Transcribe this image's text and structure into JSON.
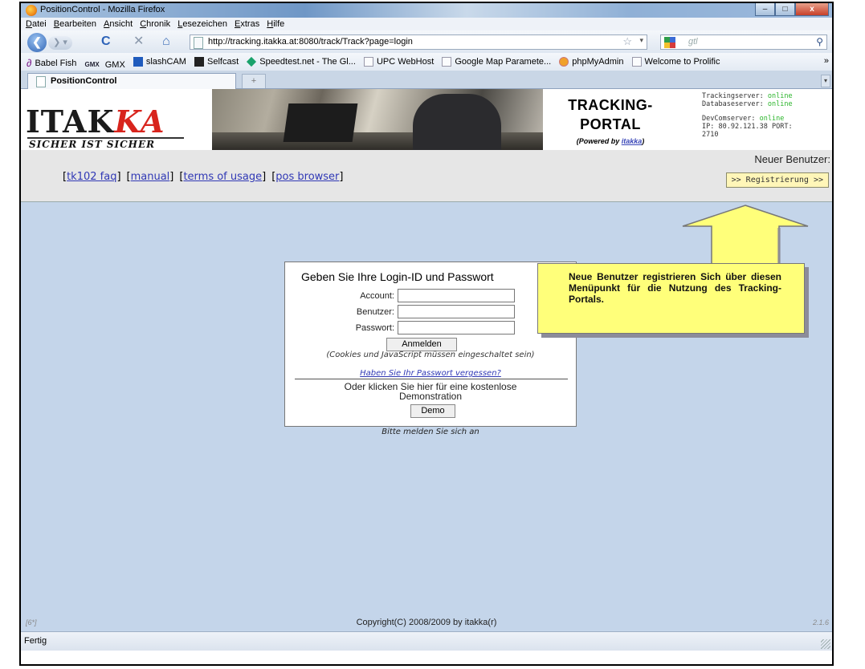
{
  "window": {
    "title": "PositionControl - Mozilla Firefox",
    "minimize": "–",
    "maximize": "□",
    "close": "x"
  },
  "menu": [
    "Datei",
    "Bearbeiten",
    "Ansicht",
    "Chronik",
    "Lesezeichen",
    "Extras",
    "Hilfe"
  ],
  "nav": {
    "back": "❮",
    "forward": "❯ ▾",
    "reload": "C",
    "stop": "✕",
    "home": "⌂",
    "url": "http://tracking.itakka.at:8080/track/Track?page=login",
    "star": "☆",
    "dropdown": "▾",
    "search_placeholder": "gtl",
    "search_icon": "⚲"
  },
  "bookmarks": [
    {
      "label": "Babel Fish",
      "icon": "fish"
    },
    {
      "label": "GMX",
      "icon": "gmx"
    },
    {
      "label": "slashCAM",
      "icon": "c1"
    },
    {
      "label": "Selfcast",
      "icon": "c2"
    },
    {
      "label": "Speedtest.net - The Gl...",
      "icon": "c3"
    },
    {
      "label": "UPC WebHost",
      "icon": "page"
    },
    {
      "label": "Google Map Paramete...",
      "icon": "page"
    },
    {
      "label": "phpMyAdmin",
      "icon": "c4"
    },
    {
      "label": "Welcome to Prolific",
      "icon": "page"
    }
  ],
  "bookmarks_more": "»",
  "tabs": {
    "active": "PositionControl",
    "new_tab": "+",
    "list": "▾"
  },
  "header": {
    "logo_main": "ITAK",
    "logo_accent": "KA",
    "logo_slogan": "SICHER IST SICHER",
    "tracking_line1": "TRACKING-",
    "tracking_line2": "PORTAL",
    "powered_prefix": "(Powered by ",
    "powered_link": "itakka",
    "powered_suffix": ")",
    "status": {
      "tracking_label": "Trackingserver:",
      "tracking_value": "online",
      "database_label": "Databaseserver:",
      "database_value": "online",
      "devcom_label": "DevComserver:",
      "devcom_value": "online",
      "ip_line": "IP: 80.92.121.38 PORT:",
      "port": "2710"
    }
  },
  "links": {
    "neuer_benutzer": "Neuer Benutzer:",
    "items": [
      "tk102 faq",
      "manual",
      "terms of usage",
      "pos browser"
    ],
    "register_button": ">> Registrierung >>"
  },
  "login": {
    "heading": "Geben Sie Ihre Login-ID und Passwort",
    "account_label": "Account:",
    "account_value": "",
    "user_label": "Benutzer:",
    "user_value": "",
    "password_label": "Passwort:",
    "password_value": "",
    "submit": "Anmelden",
    "note": "(Cookies und JavaScript müssen eingeschaltet sein)",
    "forgot": "Haben Sie Ihr Passwort vergessen?",
    "demo_text_1": "Oder klicken Sie hier für eine kostenlose",
    "demo_text_2": "Demonstration",
    "demo_button": "Demo",
    "bitte": "Bitte melden Sie sich an"
  },
  "callout": {
    "text": "Neue Benutzer registrieren Sich über diesen Menüpunkt für die Nutzung des Tracking-Portals."
  },
  "page_footer": {
    "left": "[6*]",
    "center": "Copyright(C) 2008/2009 by itakka(r)",
    "right": "2.1.6"
  },
  "statusbar": {
    "text": "Fertig"
  },
  "colors": {
    "page_bg": "#c4d5ea",
    "callout_bg": "#ffff7a",
    "logo_accent": "#d8241d",
    "online": "#2bb52b",
    "link": "#3038b5"
  }
}
